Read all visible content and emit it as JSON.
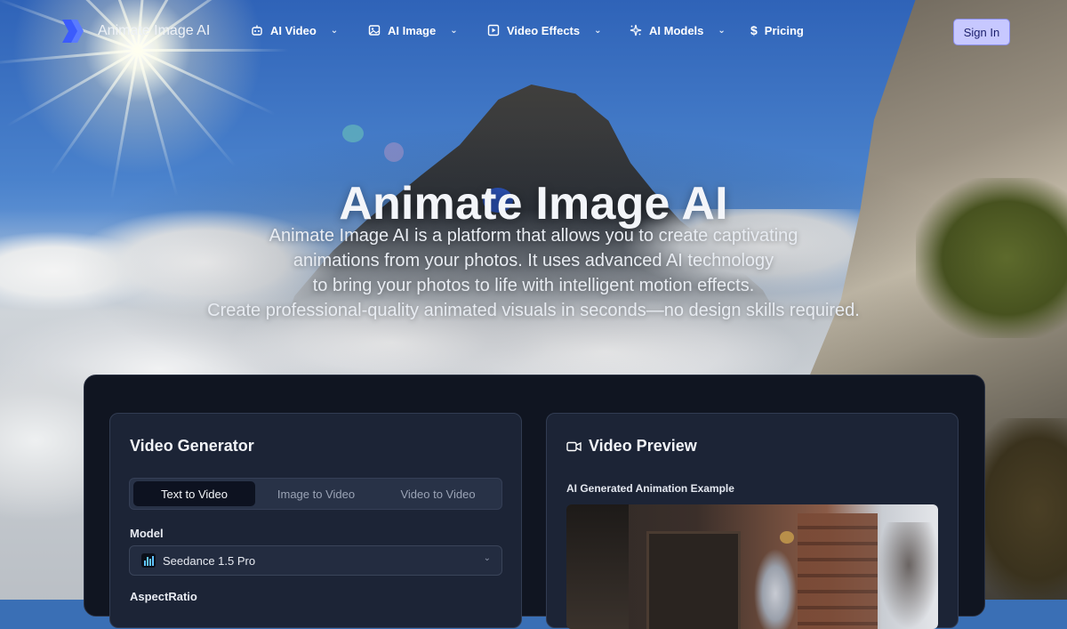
{
  "brand": {
    "name": "Animate Image AI",
    "accent": "#3b5bfd"
  },
  "nav": {
    "items": [
      {
        "label": "AI Video",
        "icon": "robot-icon",
        "has_dropdown": true
      },
      {
        "label": "AI Image",
        "icon": "image-icon",
        "has_dropdown": true
      },
      {
        "label": "Video Effects",
        "icon": "play-square-icon",
        "has_dropdown": true
      },
      {
        "label": "AI Models",
        "icon": "sparkles-icon",
        "has_dropdown": true
      },
      {
        "label": "Pricing",
        "icon": "dollar-icon",
        "has_dropdown": false
      }
    ],
    "signin_label": "Sign In"
  },
  "hero": {
    "title": "Animate Image AI",
    "description_lines": [
      "Animate Image AI is a platform that allows you to create captivating",
      "animations from your photos. It uses advanced AI technology",
      "to bring your photos to life with intelligent motion effects.",
      "Create professional-quality animated visuals in seconds—no design skills required."
    ]
  },
  "generator": {
    "title": "Video Generator",
    "tabs": [
      {
        "label": "Text to Video",
        "active": true
      },
      {
        "label": "Image to Video",
        "active": false
      },
      {
        "label": "Video to Video",
        "active": false
      }
    ],
    "model_label": "Model",
    "model_value": "Seedance 1.5 Pro",
    "aspect_label": "AspectRatio"
  },
  "preview": {
    "title": "Video Preview",
    "subtitle": "AI Generated Animation Example"
  }
}
